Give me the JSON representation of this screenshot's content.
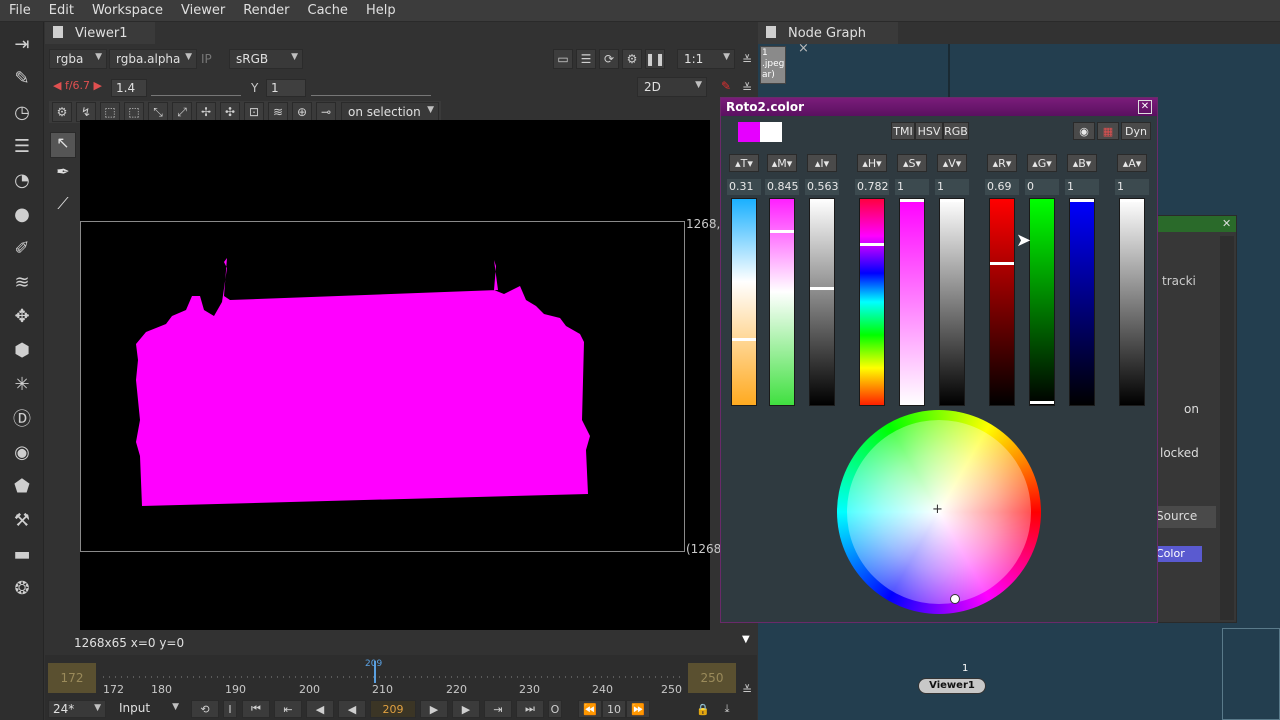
{
  "menubar": {
    "items": [
      "File",
      "Edit",
      "Workspace",
      "Viewer",
      "Render",
      "Cache",
      "Help"
    ]
  },
  "viewer": {
    "tab_label": "Viewer1",
    "channels": "rgba",
    "alpha_channel": "rgba.alpha",
    "ip_label": "IP",
    "colorspace": "sRGB",
    "zoom": "1:1",
    "fstop": "f/6.7",
    "gain": "1.4",
    "gamma_label": "Y",
    "gamma": "1",
    "view_mode": "2D",
    "selection_mode": "on selection",
    "format_label_top": "1268,",
    "format_label_bottom": "(1268",
    "status": "1268x65  x=0 y=0"
  },
  "timeline": {
    "in_frame": "172",
    "out_frame": "250",
    "current_frame": "209",
    "playhead_label": "209",
    "ticks": [
      "172",
      "180",
      "190",
      "200",
      "210",
      "220",
      "230",
      "240",
      "250"
    ],
    "fps": "24*",
    "input_mode": "Input",
    "i_label": "I",
    "o_label": "O",
    "step": "10"
  },
  "nodegraph": {
    "tab_label": "Node Graph",
    "viewer_node": "Viewer1",
    "viewer_input": "1",
    "read_node": "1\n.jpeg\nar)"
  },
  "color_dialog": {
    "title": "Roto2.color",
    "modes": [
      "TMI",
      "HSV",
      "RGB"
    ],
    "dyn_label": "Dyn",
    "channels": [
      {
        "label": "T",
        "value": "0.31"
      },
      {
        "label": "M",
        "value": "0.845"
      },
      {
        "label": "I",
        "value": "0.563"
      },
      {
        "label": "H",
        "value": "0.782"
      },
      {
        "label": "S",
        "value": "1"
      },
      {
        "label": "V",
        "value": "1"
      },
      {
        "label": "R",
        "value": "0.69"
      },
      {
        "label": "G",
        "value": "0"
      },
      {
        "label": "B",
        "value": "1"
      },
      {
        "label": "A",
        "value": "1"
      }
    ],
    "current_color": "#e600ff",
    "original_color": "#ffffff"
  },
  "bg_panel": {
    "tracki": "tracki",
    "on": "on",
    "locked": "locked",
    "source": "Source",
    "color": "Color"
  }
}
